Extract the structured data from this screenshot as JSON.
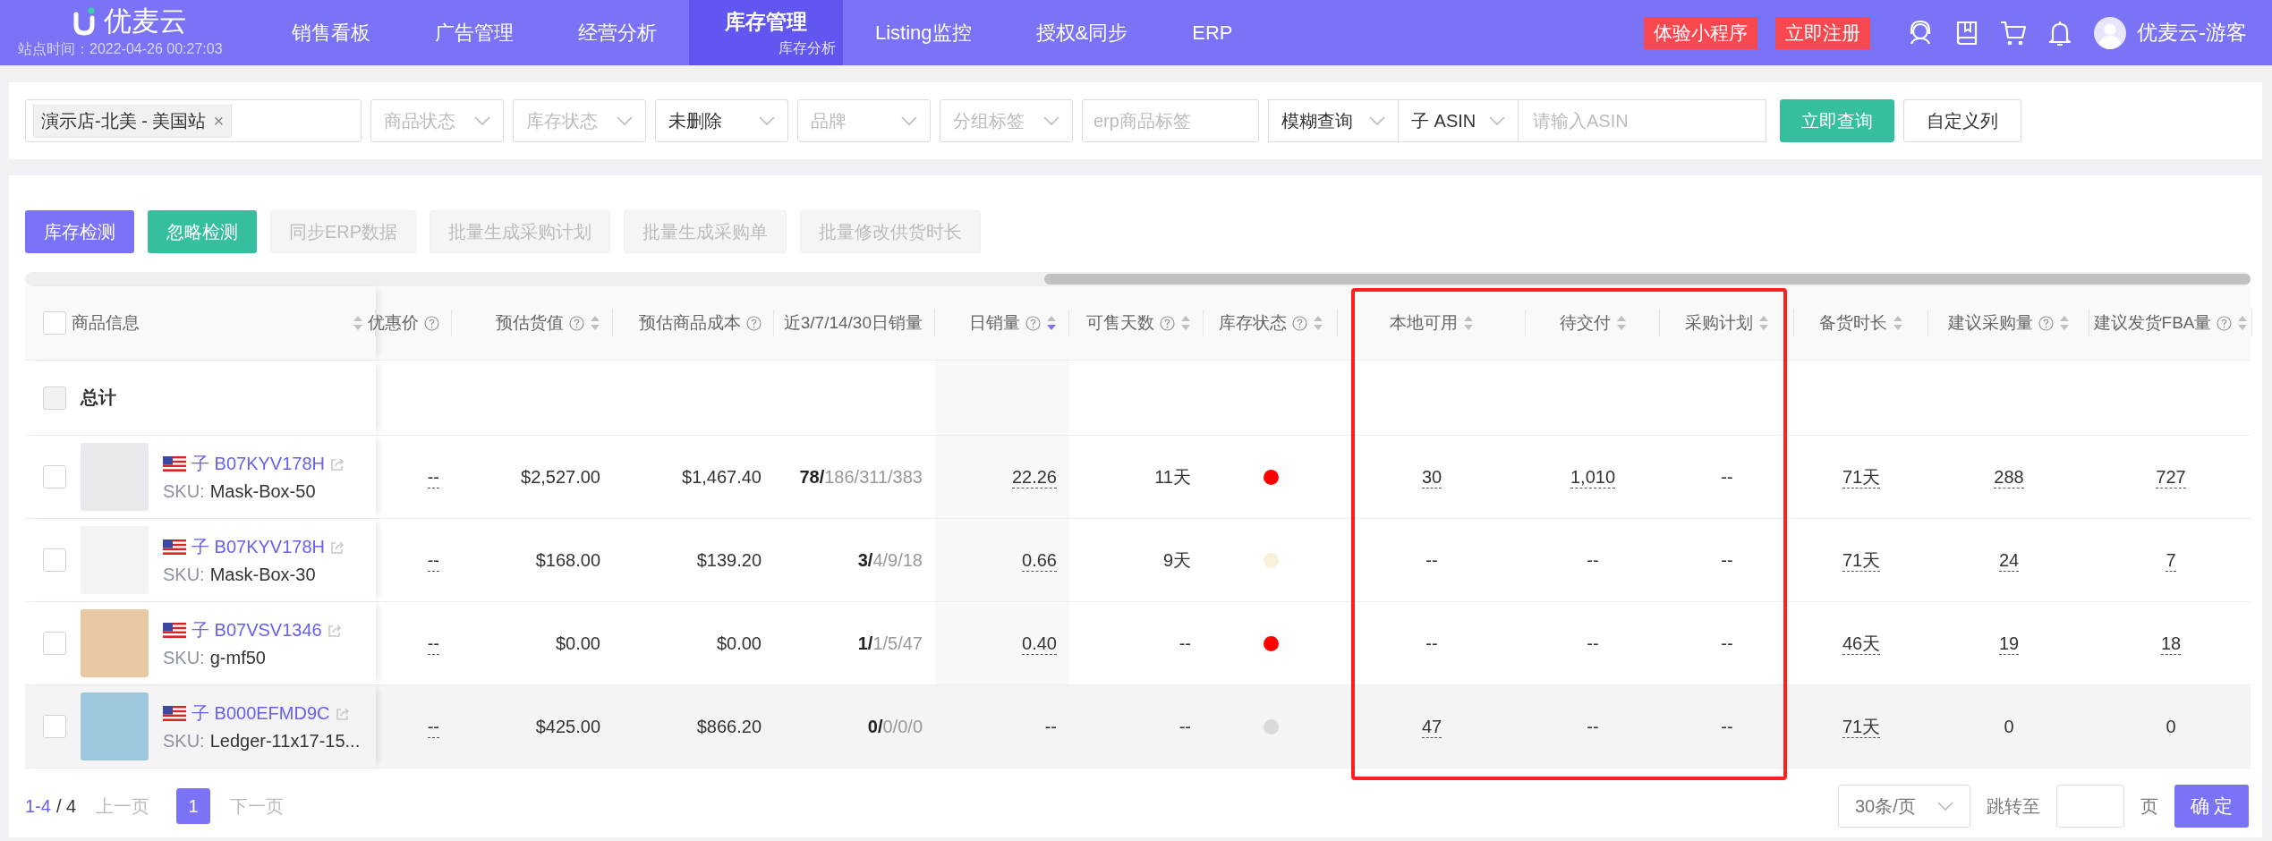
{
  "header": {
    "logo": "优麦云",
    "site_time": "站点时间：2022-04-26 00:27:03",
    "nav": [
      {
        "label": "销售看板",
        "selected": false
      },
      {
        "label": "广告管理",
        "selected": false
      },
      {
        "label": "经营分析",
        "selected": false
      },
      {
        "label": "库存管理",
        "sub": "库存分析",
        "selected": true
      },
      {
        "label": "Listing监控",
        "selected": false
      },
      {
        "label": "授权&同步",
        "selected": false
      },
      {
        "label": "ERP",
        "selected": false
      }
    ],
    "promo_buttons": [
      "体验小程序",
      "立即注册"
    ],
    "user": "优麦云-游客"
  },
  "filters": {
    "store_tag": "演示店-北美 - 美国站",
    "tag_remove": "×",
    "selects": [
      {
        "placeholder": "商品状态"
      },
      {
        "placeholder": "库存状态"
      },
      {
        "value": "未删除"
      },
      {
        "placeholder": "品牌"
      },
      {
        "placeholder": "分组标签"
      }
    ],
    "erp_tag": {
      "placeholder": "erp商品标签"
    },
    "match_mode": "模糊查询",
    "asin_type": "子 ASIN",
    "asin_input": {
      "placeholder": "请输入ASIN"
    },
    "search_button": "立即查询",
    "columns_button": "自定义列"
  },
  "actions": [
    {
      "label": "库存检测",
      "kind": "primary",
      "disabled": false
    },
    {
      "label": "忽略检测",
      "kind": "success",
      "disabled": false
    },
    {
      "label": "同步ERP数据",
      "kind": "plain",
      "disabled": true
    },
    {
      "label": "批量生成采购计划",
      "kind": "plain",
      "disabled": true
    },
    {
      "label": "批量生成采购单",
      "kind": "plain",
      "disabled": true
    },
    {
      "label": "批量修改供货时长",
      "kind": "plain",
      "disabled": true
    }
  ],
  "table": {
    "header_checked": false,
    "info_column": {
      "label": "商品信息",
      "sortable": true,
      "sort_desc": false
    },
    "columns": [
      {
        "label": "优惠价",
        "help": true,
        "sortable": false,
        "boxed": false,
        "kind": "text"
      },
      {
        "label": "预估货值",
        "help": true,
        "sortable": true,
        "sort_desc": false,
        "boxed": false,
        "kind": "text"
      },
      {
        "label": "预估商品成本",
        "help": true,
        "sortable": false,
        "boxed": false,
        "kind": "text"
      },
      {
        "label": "近3/7/14/30日销量",
        "help": false,
        "sortable": false,
        "boxed": false,
        "kind": "text"
      },
      {
        "label": "日销量",
        "help": true,
        "sortable": true,
        "sort_desc": true,
        "boxed": false,
        "kind": "text"
      },
      {
        "label": "可售天数",
        "help": true,
        "sortable": true,
        "sort_desc": false,
        "boxed": false,
        "kind": "text"
      },
      {
        "label": "库存状态",
        "help": true,
        "sortable": true,
        "sort_desc": false,
        "boxed": false,
        "kind": "dot"
      },
      {
        "label": "本地可用",
        "help": false,
        "sortable": true,
        "sort_desc": false,
        "boxed": true,
        "kind": "text"
      },
      {
        "label": "待交付",
        "help": false,
        "sortable": true,
        "sort_desc": false,
        "boxed": true,
        "kind": "text"
      },
      {
        "label": "采购计划",
        "help": false,
        "sortable": true,
        "sort_desc": false,
        "boxed": true,
        "kind": "text"
      },
      {
        "label": "备货时长",
        "help": false,
        "sortable": true,
        "sort_desc": false,
        "boxed": false,
        "kind": "text"
      },
      {
        "label": "建议采购量",
        "help": true,
        "sortable": true,
        "sort_desc": false,
        "boxed": false,
        "kind": "text"
      },
      {
        "label": "建议发货FBA量",
        "help": true,
        "sortable": true,
        "sort_desc": false,
        "boxed": false,
        "kind": "text"
      }
    ],
    "total_label": "总计",
    "total_checkbox_disabled": true,
    "rows": [
      {
        "selected": false,
        "hovered": false,
        "asin_prefix": "子",
        "asin": "B07KYV178H",
        "sku_label": "SKU:",
        "sku": "Mask-Box-50",
        "cells": [
          {
            "text": "--",
            "hint": true
          },
          {
            "text": "$2,527.00"
          },
          {
            "text": "$1,467.40"
          },
          {
            "text": "**78/**186/311/383"
          },
          {
            "text": "22.26",
            "hint": true
          },
          {
            "text": "11天"
          },
          {
            "color": "#ff0000"
          },
          {
            "text": "30",
            "hint": true
          },
          {
            "text": "1,010",
            "hint": true
          },
          {
            "text": "--"
          },
          {
            "text": "71天",
            "hint": true
          },
          {
            "text": "288",
            "hint": true
          },
          {
            "text": "727",
            "hint": true
          }
        ]
      },
      {
        "selected": false,
        "hovered": false,
        "asin_prefix": "子",
        "asin": "B07KYV178H",
        "sku_label": "SKU:",
        "sku": "Mask-Box-30",
        "cells": [
          {
            "text": "--",
            "hint": true
          },
          {
            "text": "$168.00"
          },
          {
            "text": "$139.20"
          },
          {
            "text": "**3/**4/9/18"
          },
          {
            "text": "0.66",
            "hint": true
          },
          {
            "text": "9天"
          },
          {
            "color": "#f7f1d9"
          },
          {
            "text": "--"
          },
          {
            "text": "--"
          },
          {
            "text": "--"
          },
          {
            "text": "71天",
            "hint": true
          },
          {
            "text": "24",
            "hint": true
          },
          {
            "text": "7",
            "hint": true
          }
        ]
      },
      {
        "selected": false,
        "hovered": false,
        "asin_prefix": "子",
        "asin": "B07VSV1346",
        "sku_label": "SKU:",
        "sku": "g-mf50",
        "cells": [
          {
            "text": "--",
            "hint": true
          },
          {
            "text": "$0.00"
          },
          {
            "text": "$0.00"
          },
          {
            "text": "**1/**1/5/47"
          },
          {
            "text": "0.40",
            "hint": true
          },
          {
            "text": "--"
          },
          {
            "color": "#ff0000"
          },
          {
            "text": "--"
          },
          {
            "text": "--"
          },
          {
            "text": "--"
          },
          {
            "text": "46天",
            "hint": true
          },
          {
            "text": "19",
            "hint": true
          },
          {
            "text": "18",
            "hint": true
          }
        ]
      },
      {
        "selected": false,
        "hovered": true,
        "asin_prefix": "子",
        "asin": "B000EFMD9C",
        "sku_label": "SKU:",
        "sku": "Ledger-11x17-15...",
        "cells": [
          {
            "text": "--",
            "hint": true
          },
          {
            "text": "$425.00"
          },
          {
            "text": "$866.20"
          },
          {
            "text": "**0/**0/0/0"
          },
          {
            "text": "--"
          },
          {
            "text": "--"
          },
          {
            "color": "#d9d9d9"
          },
          {
            "text": "47",
            "hint": true
          },
          {
            "text": "--"
          },
          {
            "text": "--"
          },
          {
            "text": "71天",
            "hint": true
          },
          {
            "text": "0"
          },
          {
            "text": "0"
          }
        ]
      }
    ]
  },
  "pagination": {
    "range": "1-4",
    "total": "/ 4",
    "prev": "上一页",
    "prev_disabled": true,
    "pages": [
      {
        "label": "1",
        "selected": true
      }
    ],
    "next": "下一页",
    "next_disabled": true,
    "page_size": "30条/页",
    "jump_label": "跳转至",
    "page_unit": "页",
    "confirm": "确 定"
  }
}
